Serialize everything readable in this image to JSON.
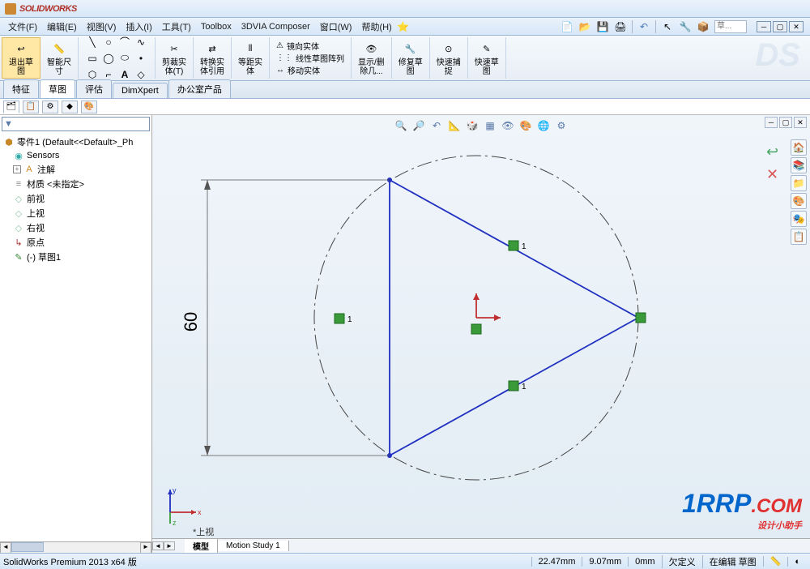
{
  "app": {
    "name": "SOLIDWORKS"
  },
  "menu": {
    "file": "文件(F)",
    "edit": "编辑(E)",
    "view": "视图(V)",
    "insert": "插入(I)",
    "tools": "工具(T)",
    "toolbox": "Toolbox",
    "composer": "3DVIA Composer",
    "window": "窗口(W)",
    "help": "帮助(H)",
    "search_placeholder": "草..."
  },
  "ribbon": {
    "exit_sketch": "退出草\n图",
    "smart_dim": "智能尺\n寸",
    "trim": "剪裁实\n体(T)",
    "convert": "转换实\n体引用",
    "offset": "等距实\n体",
    "mirror": "镜向实体",
    "linear_pattern": "线性草图阵列",
    "move": "移动实体",
    "display_del": "显示/删\n除几...",
    "repair": "修复草\n图",
    "quick_snap": "快速捕\n捉",
    "rapid_sketch": "快速草\n图"
  },
  "tabs": {
    "features": "特征",
    "sketch": "草图",
    "evaluate": "评估",
    "dimxpert": "DimXpert",
    "office": "办公室产品"
  },
  "tree": {
    "root": "零件1  (Default<<Default>_Ph",
    "sensors": "Sensors",
    "annotations": "注解",
    "material": "材质 <未指定>",
    "front": "前视",
    "top": "上视",
    "right": "右视",
    "origin": "原点",
    "sketch1": "(-) 草图1"
  },
  "sketch": {
    "dimension": "60",
    "relation_label": "1",
    "view_indicator": "*上视",
    "triad_x": "x",
    "triad_y": "y",
    "triad_z": "z"
  },
  "conf_tabs": {
    "model": "模型",
    "motion": "Motion Study 1"
  },
  "status": {
    "version": "SolidWorks Premium 2013 x64 版",
    "x": "22.47mm",
    "y": "9.07mm",
    "z": "0mm",
    "defined": "欠定义",
    "editing": "在编辑 草图"
  },
  "watermark": {
    "text": "1RRP",
    "domain": ".COM",
    "sub": "设计小助手"
  }
}
